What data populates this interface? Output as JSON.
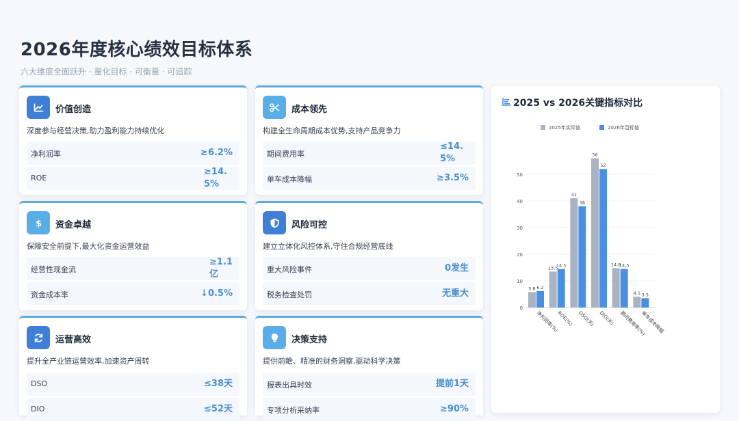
{
  "header": {
    "title": "2026年度核心绩效目标体系",
    "subtitle": "六大维度全面跃升 · 量化目标 · 可衡量 · 可追踪"
  },
  "cards": [
    {
      "title": "价值创造",
      "icon": "chart-line-icon",
      "icon_color": "#3f7fd6",
      "desc": "深度参与经营决策,助力盈利能力持续优化",
      "metrics": [
        {
          "label": "净利润率",
          "value": "≥6.2%"
        },
        {
          "label": "ROE",
          "value": "≥14.5%"
        }
      ]
    },
    {
      "title": "成本领先",
      "icon": "scissors-icon",
      "icon_color": "#5aaee8",
      "desc": "构建全生命周期成本优势,支持产品竞争力",
      "metrics": [
        {
          "label": "期间费用率",
          "value": "≤14.5%"
        },
        {
          "label": "单车成本降幅",
          "value": "≥3.5%"
        }
      ]
    },
    {
      "title": "资金卓越",
      "icon": "dollar-icon",
      "icon_color": "#5aaee8",
      "desc": "保障安全前提下,最大化资金运营效益",
      "metrics": [
        {
          "label": "经营性现金流",
          "value": "≥1.1亿"
        },
        {
          "label": "资金成本率",
          "value": "↓0.5%"
        }
      ]
    },
    {
      "title": "风险可控",
      "icon": "shield-icon",
      "icon_color": "#3f7fd6",
      "desc": "建立立体化风控体系,守住合规经营底线",
      "metrics": [
        {
          "label": "重大风险事件",
          "value": "0发生"
        },
        {
          "label": "税务检查处罚",
          "value": "无重大"
        }
      ]
    },
    {
      "title": "运营高效",
      "icon": "refresh-icon",
      "icon_color": "#3f7fd6",
      "desc": "提升全产业链运营效率,加速资产周转",
      "metrics": [
        {
          "label": "DSO",
          "value": "≤38天"
        },
        {
          "label": "DIO",
          "value": "≤52天"
        }
      ]
    },
    {
      "title": "决策支持",
      "icon": "lightbulb-icon",
      "icon_color": "#5aaee8",
      "desc": "提供前瞻、精准的财务洞察,驱动科学决策",
      "metrics": [
        {
          "label": "报表出具时效",
          "value": "提前1天"
        },
        {
          "label": "专项分析采纳率",
          "value": "≥90%"
        }
      ]
    }
  ],
  "chart_panel": {
    "title": "2025 vs 2026关键指标对比",
    "icon": "bar-chart-icon"
  },
  "chart_data": {
    "type": "bar",
    "categories": [
      "净利润率(%)",
      "ROE(%)",
      "DSO(天)",
      "DIO(天)",
      "期间费用率(%)",
      "单车成本降幅"
    ],
    "series": [
      {
        "name": "2025年实际值",
        "values": [
          5.8,
          13.5,
          41,
          56,
          14.8,
          4.1
        ],
        "color": "#a9b3c1"
      },
      {
        "name": "2026年目标值",
        "values": [
          6.2,
          14.5,
          38,
          52,
          14.5,
          3.5
        ],
        "color": "#4a90e2"
      }
    ],
    "ylim": [
      0,
      60
    ],
    "yticks": [
      "0",
      "10",
      "20",
      "30",
      "40",
      "50"
    ],
    "grid": true,
    "legend": "top-center"
  }
}
